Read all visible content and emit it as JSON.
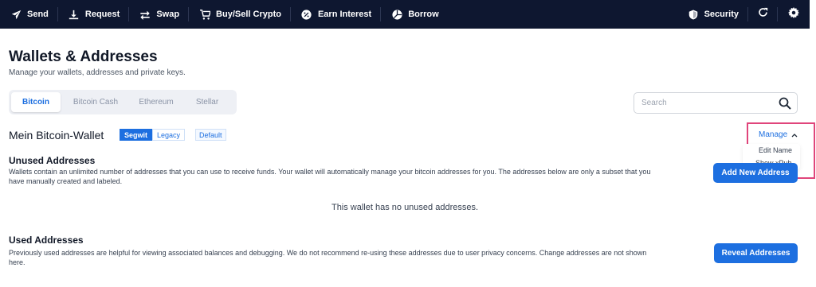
{
  "nav": {
    "items": [
      {
        "label": "Send",
        "icon": "paper-plane-icon"
      },
      {
        "label": "Request",
        "icon": "download-icon"
      },
      {
        "label": "Swap",
        "icon": "swap-arrows-icon"
      },
      {
        "label": "Buy/Sell Crypto",
        "icon": "cart-icon"
      },
      {
        "label": "Earn Interest",
        "icon": "percent-icon"
      },
      {
        "label": "Borrow",
        "icon": "pie-icon"
      }
    ],
    "security_label": "Security",
    "refresh_icon": "refresh-icon",
    "settings_icon": "gear-icon",
    "background": "#0e1730"
  },
  "header": {
    "title": "Wallets & Addresses",
    "subtitle": "Manage your wallets, addresses and private keys."
  },
  "tabs": [
    {
      "label": "Bitcoin",
      "active": true
    },
    {
      "label": "Bitcoin Cash",
      "active": false
    },
    {
      "label": "Ethereum",
      "active": false
    },
    {
      "label": "Stellar",
      "active": false
    }
  ],
  "search": {
    "placeholder": "Search",
    "value": ""
  },
  "wallet": {
    "name": "Mein Bitcoin-Wallet",
    "segwit_label": "Segwit",
    "legacy_label": "Legacy",
    "default_label": "Default",
    "manage_label": "Manage",
    "menu": {
      "edit_name": "Edit Name",
      "show_xpub": "Show xPub"
    }
  },
  "unused": {
    "title": "Unused Addresses",
    "description": "Wallets contain an unlimited number of addresses that you can use to receive funds. Your wallet will automatically manage your bitcoin addresses for you. The addresses below are only a subset that you have manually created and labeled.",
    "button_label": "Add New Address",
    "empty_message": "This wallet has no unused addresses."
  },
  "used": {
    "title": "Used Addresses",
    "description": "Previously used addresses are helpful for viewing associated balances and debugging. We do not recommend re-using these addresses due to user privacy concerns. Change addresses are not shown here.",
    "button_label": "Reveal Addresses"
  },
  "colors": {
    "accent": "#1d6fe0",
    "highlight": "#e0457b"
  }
}
